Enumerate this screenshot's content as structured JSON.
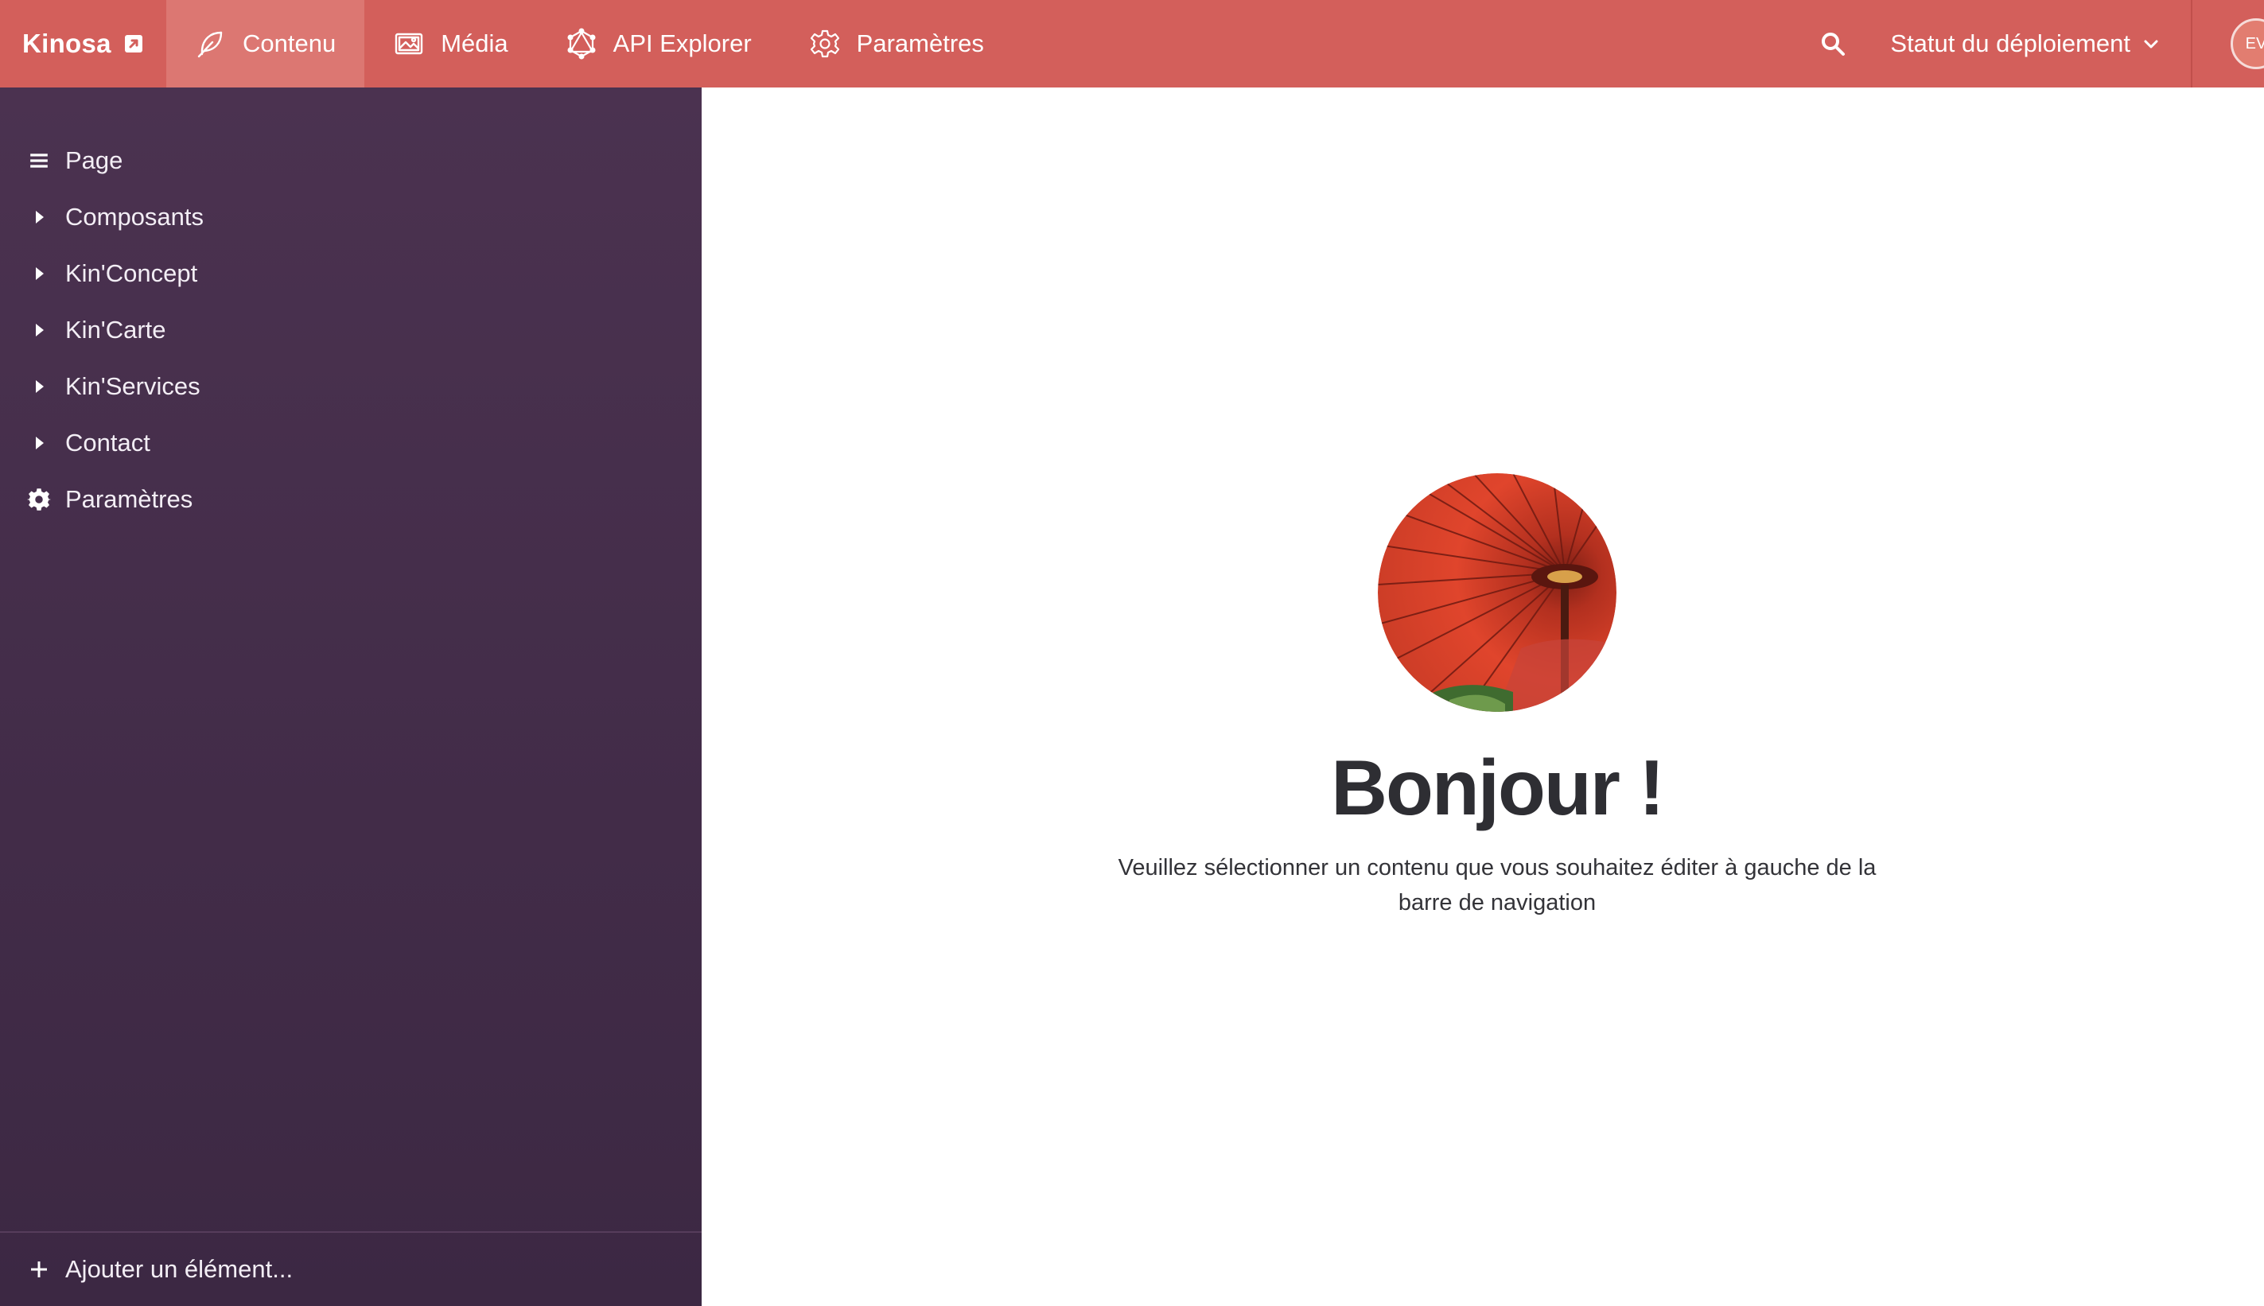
{
  "app": {
    "brand": "Kinosa"
  },
  "header": {
    "tabs": [
      {
        "label": "Contenu",
        "icon": "feather-icon",
        "active": true
      },
      {
        "label": "Média",
        "icon": "image-icon",
        "active": false
      },
      {
        "label": "API Explorer",
        "icon": "graphql-icon",
        "active": false
      },
      {
        "label": "Paramètres",
        "icon": "gear-icon",
        "active": false
      }
    ],
    "deploy_label": "Statut du déploiement",
    "avatar_initials": "EV"
  },
  "sidebar": {
    "items": [
      {
        "label": "Page",
        "icon": "menu-icon"
      },
      {
        "label": "Composants",
        "icon": "caret-right-icon"
      },
      {
        "label": "Kin'Concept",
        "icon": "caret-right-icon"
      },
      {
        "label": "Kin'Carte",
        "icon": "caret-right-icon"
      },
      {
        "label": "Kin'Services",
        "icon": "caret-right-icon"
      },
      {
        "label": "Contact",
        "icon": "caret-right-icon"
      },
      {
        "label": "Paramètres",
        "icon": "gear-icon"
      }
    ],
    "add_label": "Ajouter un élément..."
  },
  "main": {
    "title": "Bonjour !",
    "description": "Veuillez sélectionner un contenu que vous souhaitez éditer à gauche de la barre de navigation"
  },
  "colors": {
    "topbar": "#d35f5b",
    "topbar_active": "#dc7772",
    "sidebar_top": "#4b3250",
    "sidebar_bottom": "#3c2843",
    "title_text": "#2e2e33"
  }
}
